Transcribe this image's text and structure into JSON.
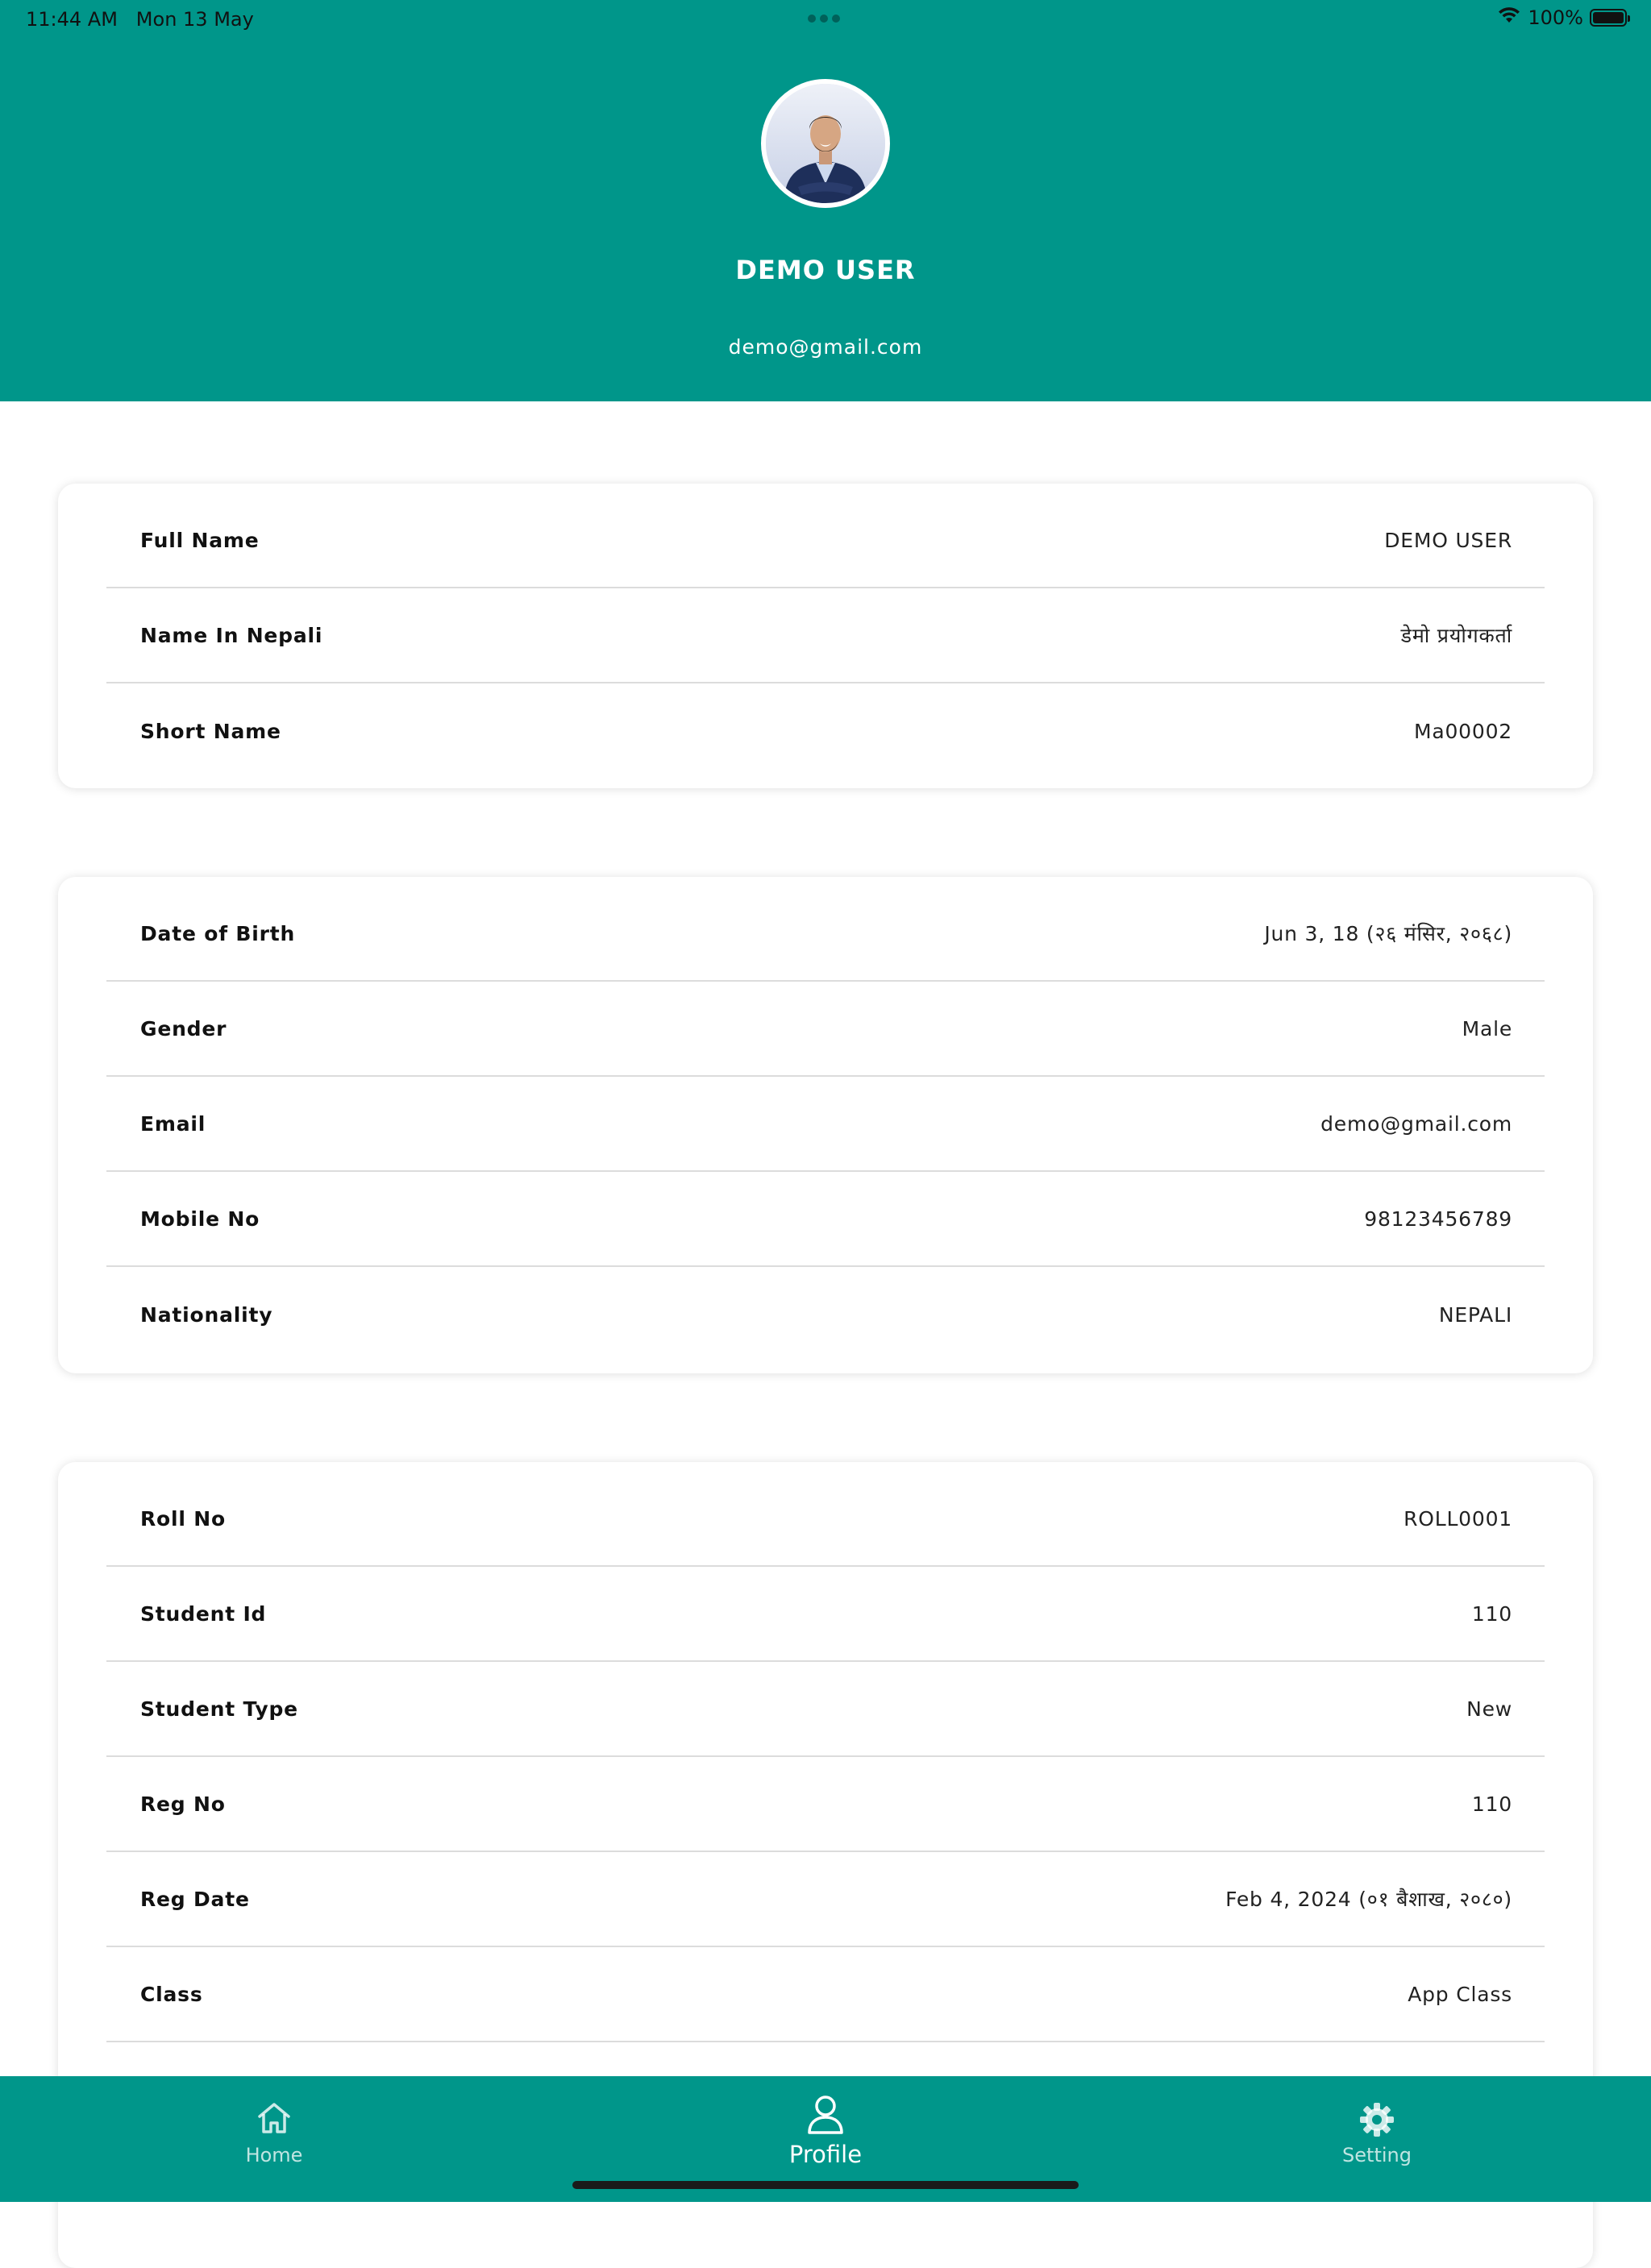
{
  "colors": {
    "primary": "#00968a",
    "background": "#ffffff",
    "divider": "#dcdcdc"
  },
  "status_bar": {
    "time": "11:44 AM   Mon 13 May",
    "battery": "100%",
    "icons": [
      "wifi-icon",
      "battery-icon"
    ]
  },
  "profile": {
    "name": "DEMO USER",
    "email": "demo@gmail.com"
  },
  "cards": [
    {
      "rows": [
        {
          "label": "Full Name",
          "value": "DEMO USER"
        },
        {
          "label": "Name In Nepali",
          "value": "डेमो प्रयोगकर्ता"
        },
        {
          "label": "Short Name",
          "value": "Ma00002"
        }
      ]
    },
    {
      "rows": [
        {
          "label": "Date of Birth",
          "value": "Jun 3, 18 (२६ मंसिर, २०६८)"
        },
        {
          "label": "Gender",
          "value": "Male"
        },
        {
          "label": "Email",
          "value": "demo@gmail.com"
        },
        {
          "label": "Mobile No",
          "value": "98123456789"
        },
        {
          "label": "Nationality",
          "value": "NEPALI"
        }
      ]
    },
    {
      "rows": [
        {
          "label": "Roll No",
          "value": "ROLL0001"
        },
        {
          "label": "Student Id",
          "value": "110"
        },
        {
          "label": "Student Type",
          "value": "New"
        },
        {
          "label": "Reg No",
          "value": "110"
        },
        {
          "label": "Reg Date",
          "value": "Feb 4, 2024 (०१ बैशाख, २०८०)"
        },
        {
          "label": "Class",
          "value": "App Class"
        }
      ]
    }
  ],
  "bottom_nav": {
    "items": [
      {
        "label": "Home",
        "icon": "home-icon",
        "active": false
      },
      {
        "label": "Profile",
        "icon": "user-icon",
        "active": true
      },
      {
        "label": "Setting",
        "icon": "gear-icon",
        "active": false
      }
    ]
  }
}
